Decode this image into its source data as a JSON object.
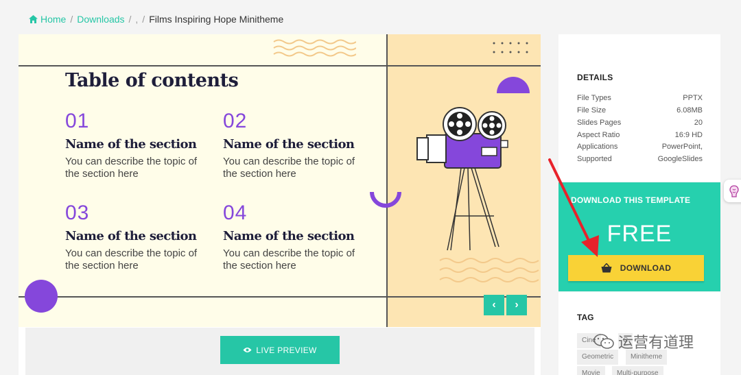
{
  "breadcrumb": {
    "home": "Home",
    "downloads": "Downloads",
    "sep": "/",
    "empty": ",",
    "current": "Films Inspiring Hope Minitheme"
  },
  "slide": {
    "title": "Table of contents",
    "items": [
      {
        "num": "01",
        "heading": "Name of the section",
        "desc": "You can describe the topic of the section here"
      },
      {
        "num": "02",
        "heading": "Name of the section",
        "desc": "You can describe the topic of the section here"
      },
      {
        "num": "03",
        "heading": "Name of the section",
        "desc": "You can describe the topic of the section here"
      },
      {
        "num": "04",
        "heading": "Name of the section",
        "desc": "You can describe the topic of the section here"
      }
    ]
  },
  "nav": {
    "prev": "‹",
    "next": "›"
  },
  "live_preview": "LIVE PREVIEW",
  "details": {
    "title": "DETAILS",
    "rows": [
      {
        "label": "File Types",
        "value": "PPTX"
      },
      {
        "label": "File Size",
        "value": "6.08MB"
      },
      {
        "label": "Slides Pages",
        "value": "20"
      },
      {
        "label": "Aspect Ratio",
        "value": "16:9 HD"
      },
      {
        "label": "Applications",
        "value": "PowerPoint,"
      },
      {
        "label": "Supported",
        "value": "GoogleSlides"
      }
    ]
  },
  "download": {
    "label": "DOWNLOAD THIS TEMPLATE",
    "price": "FREE",
    "button": "DOWNLOAD"
  },
  "tags": {
    "title": "TAG",
    "items": [
      "Cine",
      "C",
      "Geometric",
      "Minitheme",
      "Movie",
      "Multi-purpose"
    ]
  },
  "watermark": "运营有道理",
  "colors": {
    "accent": "#26c6a6",
    "purple": "#8547db",
    "yellow": "#f9d236"
  }
}
